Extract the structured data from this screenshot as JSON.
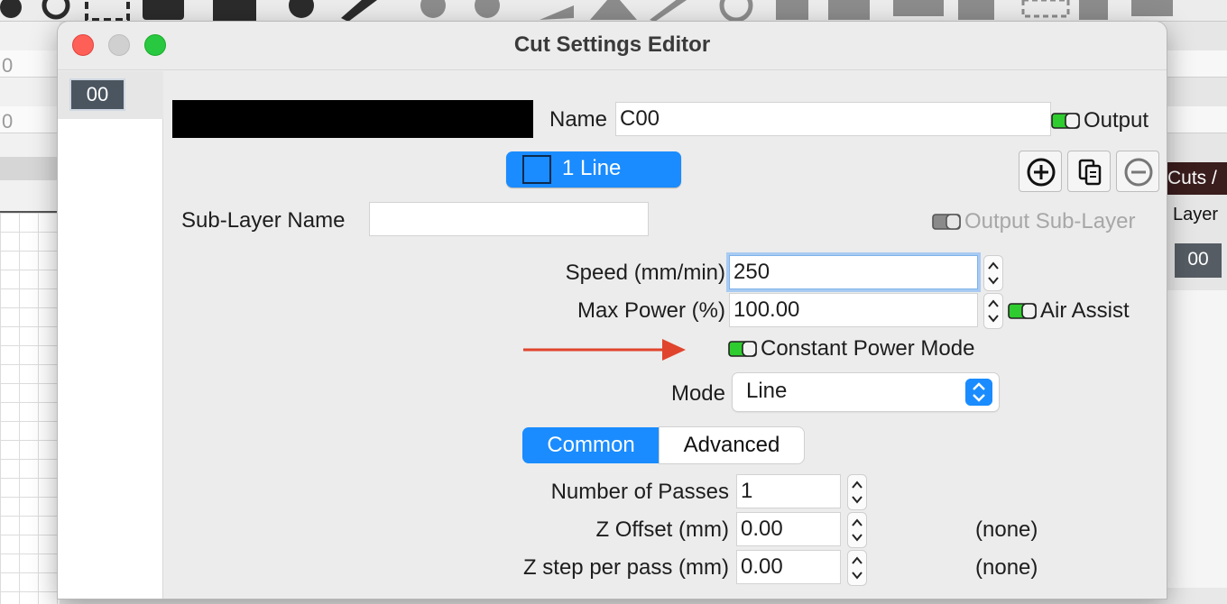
{
  "background": {
    "left_fields": [
      "0",
      "0"
    ],
    "cuts_header": "Cuts /",
    "layer_column": "Layer",
    "layer_cell": "00"
  },
  "window": {
    "title": "Cut Settings Editor"
  },
  "layer_list": {
    "selected_item": "00"
  },
  "form": {
    "name_label": "Name",
    "name_value": "C00",
    "output_label": "Output",
    "line_button_label": "1 Line",
    "sublayer_name_label": "Sub-Layer Name",
    "sublayer_name_value": "",
    "output_sublayer_label": "Output Sub-Layer",
    "speed_label": "Speed (mm/min)",
    "speed_value": "250",
    "max_power_label": "Max Power (%)",
    "max_power_value": "100.00",
    "air_assist_label": "Air Assist",
    "constant_power_label": "Constant Power Mode",
    "mode_label": "Mode",
    "mode_value": "Line",
    "tabs": {
      "common": "Common",
      "advanced": "Advanced",
      "active": "Common"
    },
    "passes_label": "Number of Passes",
    "passes_value": "1",
    "z_offset_label": "Z Offset (mm)",
    "z_offset_value": "0.00",
    "z_offset_note": "(none)",
    "z_step_label": "Z step per pass (mm)",
    "z_step_value": "0.00",
    "z_step_note": "(none)"
  },
  "colors": {
    "accent_blue": "#1a8cff",
    "toggle_green": "#2ecc2e",
    "annotation_arrow": "#e0442c",
    "layer_color_swatch": "#000000"
  },
  "icons": [
    "plus-circle-icon",
    "copy-icon",
    "minus-circle-icon",
    "stepper-icon",
    "toggle-icon",
    "select-arrows-icon",
    "arrow-icon"
  ]
}
